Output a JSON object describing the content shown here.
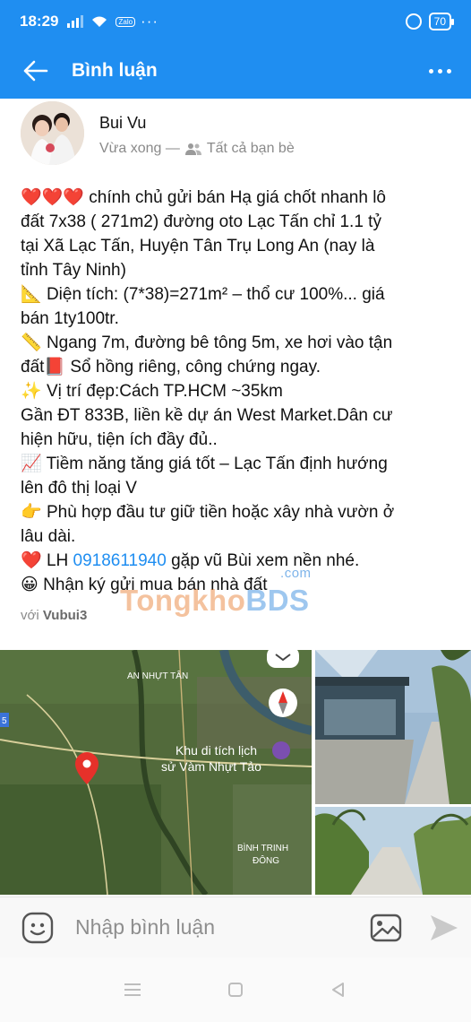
{
  "status_bar": {
    "time": "18:29",
    "zalo": "Zalo",
    "extra": "···",
    "battery": "70"
  },
  "header": {
    "title": "Bình luận"
  },
  "post": {
    "author": "Bui Vu",
    "time": "Vừa xong —",
    "privacy": "Tất cả bạn bè",
    "lines": [
      "chính chủ gửi bán Hạ giá chốt nhanh lô",
      "đất 7x38 ( 271m2) đường oto Lạc Tấn chỉ 1.1 tỷ",
      "tại Xã Lạc Tấn, Huyện Tân Trụ Long An (nay là",
      "tỉnh Tây Ninh)",
      "Diện tích: (7*38)=271m² – thổ cư 100%... giá",
      "bán 1ty100tr.",
      "Ngang 7m, đường bê tông 5m, xe hơi vào tận",
      "đất",
      "Sổ hồng riêng, công chứng ngay.",
      "Vị trí đẹp:Cách TP.HCM ~35km",
      "Gần ĐT 833B, liền kề dự án West Market.Dân cư",
      "hiện hữu, tiện ích đầy đủ..",
      "Tiềm năng tăng giá tốt – Lạc Tấn định hướng",
      "lên đô thị loại V",
      "Phù hợp đầu tư giữ tiền hoặc xây nhà vườn ở",
      "lâu dài.",
      "LH",
      "0918611940",
      "gặp vũ Bùi xem nền nhé.",
      "Nhận ký gửi mua bán nhà đất"
    ],
    "tagged_prefix": "với",
    "tagged_name": "Vubui3"
  },
  "watermark": {
    "left": "Tongkho",
    "right": "BDS",
    "suffix": ".com"
  },
  "map": {
    "label_top": "AN NHỰT TÂN",
    "label_site_1": "Khu di tích lịch",
    "label_site_2": "sử Vàm Nhựt Tảo",
    "label_bottom_1": "BÌNH TRINH",
    "label_bottom_2": "ĐÔNG",
    "route_badge": "5"
  },
  "comment_bar": {
    "placeholder": "Nhập bình luận"
  },
  "colors": {
    "primary": "#1f8ef1",
    "heart": "#d9213a",
    "phone_link": "#1f8ef1"
  },
  "icons": [
    "back-arrow-icon",
    "more-icon",
    "friends-icon",
    "heart-icon",
    "ruler-triangle-icon",
    "ruler-icon",
    "book-icon",
    "sparkles-icon",
    "chart-up-icon",
    "point-right-icon",
    "grin-icon",
    "emoji-icon",
    "image-icon",
    "send-icon",
    "menu-icon",
    "home-square-icon",
    "back-triangle-icon"
  ]
}
